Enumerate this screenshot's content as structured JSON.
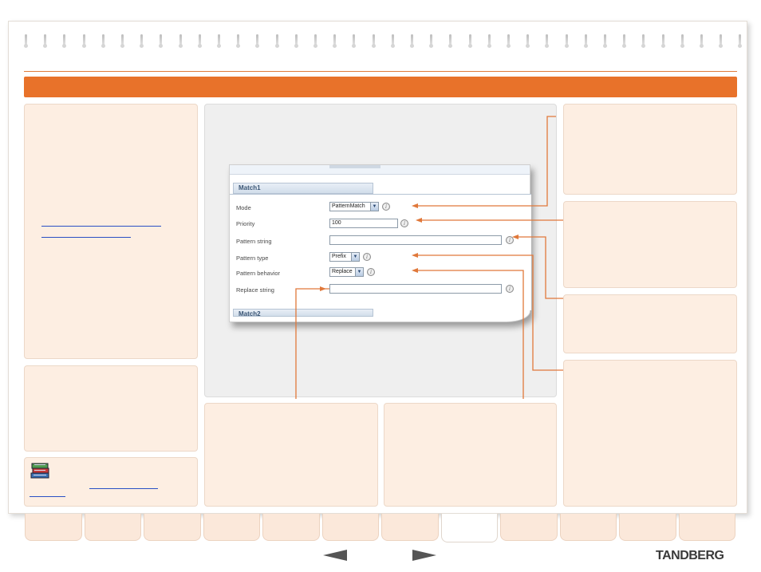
{
  "form": {
    "section_match1": "Match1",
    "section_match2": "Match2",
    "mode": {
      "label": "Mode",
      "value": "PatternMatch"
    },
    "priority": {
      "label": "Priority",
      "value": "100"
    },
    "pattern_string": {
      "label": "Pattern string",
      "value": ""
    },
    "pattern_type": {
      "label": "Pattern type",
      "value": "Prefix"
    },
    "pattern_behavior": {
      "label": "Pattern behavior",
      "value": "Replace"
    },
    "replace_string": {
      "label": "Replace string",
      "value": ""
    },
    "info_glyph": "i",
    "dropdown_glyph": "▼"
  },
  "footer": {
    "logo": "TANDBERG"
  },
  "colors": {
    "accent": "#e8722a",
    "panel": "#fdeee2",
    "callout": "#e0783a"
  }
}
